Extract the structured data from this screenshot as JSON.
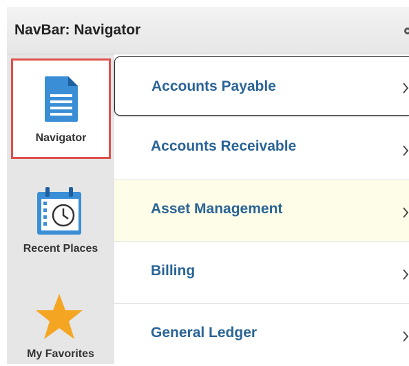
{
  "header": {
    "title": "NavBar: Navigator"
  },
  "sidebar": {
    "items": [
      {
        "label": "Navigator"
      },
      {
        "label": "Recent Places"
      },
      {
        "label": "My Favorites"
      }
    ]
  },
  "menu": {
    "items": [
      {
        "label": "Accounts Payable"
      },
      {
        "label": "Accounts Receivable"
      },
      {
        "label": "Asset Management"
      },
      {
        "label": "Billing"
      },
      {
        "label": "General Ledger"
      }
    ]
  },
  "colors": {
    "accent_blue": "#2a6496",
    "icon_blue": "#3a8ed6",
    "active_border": "#e0504a",
    "star": "#f4a623",
    "hover_row": "#fdfde8"
  }
}
